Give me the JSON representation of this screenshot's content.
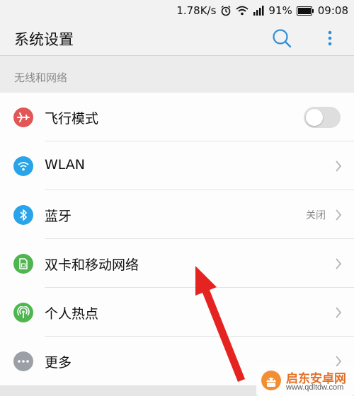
{
  "status_bar": {
    "net_speed": "1.78K/s",
    "battery_percent": "91%",
    "time": "09:08",
    "icons": [
      "alarm-icon",
      "wifi-icon",
      "signal-icon",
      "battery-icon"
    ]
  },
  "header": {
    "title": "系统设置",
    "actions": [
      "search-icon",
      "more-vert-icon"
    ],
    "accent_color": "#2f8fd6"
  },
  "section": {
    "title": "无线和网络"
  },
  "items": [
    {
      "label": "飞行模式",
      "icon": "airplane-icon",
      "icon_color": "#e25656",
      "control": "toggle",
      "toggle_on": false
    },
    {
      "label": "WLAN",
      "icon": "wifi-icon",
      "icon_color": "#2aa4e8",
      "value": "",
      "control": "chevron"
    },
    {
      "label": "蓝牙",
      "icon": "bluetooth-icon",
      "icon_color": "#2aa4e8",
      "value": "关闭",
      "control": "chevron"
    },
    {
      "label": "双卡和移动网络",
      "icon": "sim-card-icon",
      "icon_color": "#4fb54f",
      "control": "chevron"
    },
    {
      "label": "个人热点",
      "icon": "hotspot-icon",
      "icon_color": "#4fb54f",
      "control": "chevron"
    },
    {
      "label": "更多",
      "icon": "more-horiz-icon",
      "icon_color": "#9aa0a6",
      "control": "chevron"
    }
  ],
  "annotation": {
    "icon": "red-arrow-icon",
    "color": "#e52421"
  },
  "watermark": {
    "name": "启东安卓网",
    "url": "www.qdltdw.com"
  }
}
